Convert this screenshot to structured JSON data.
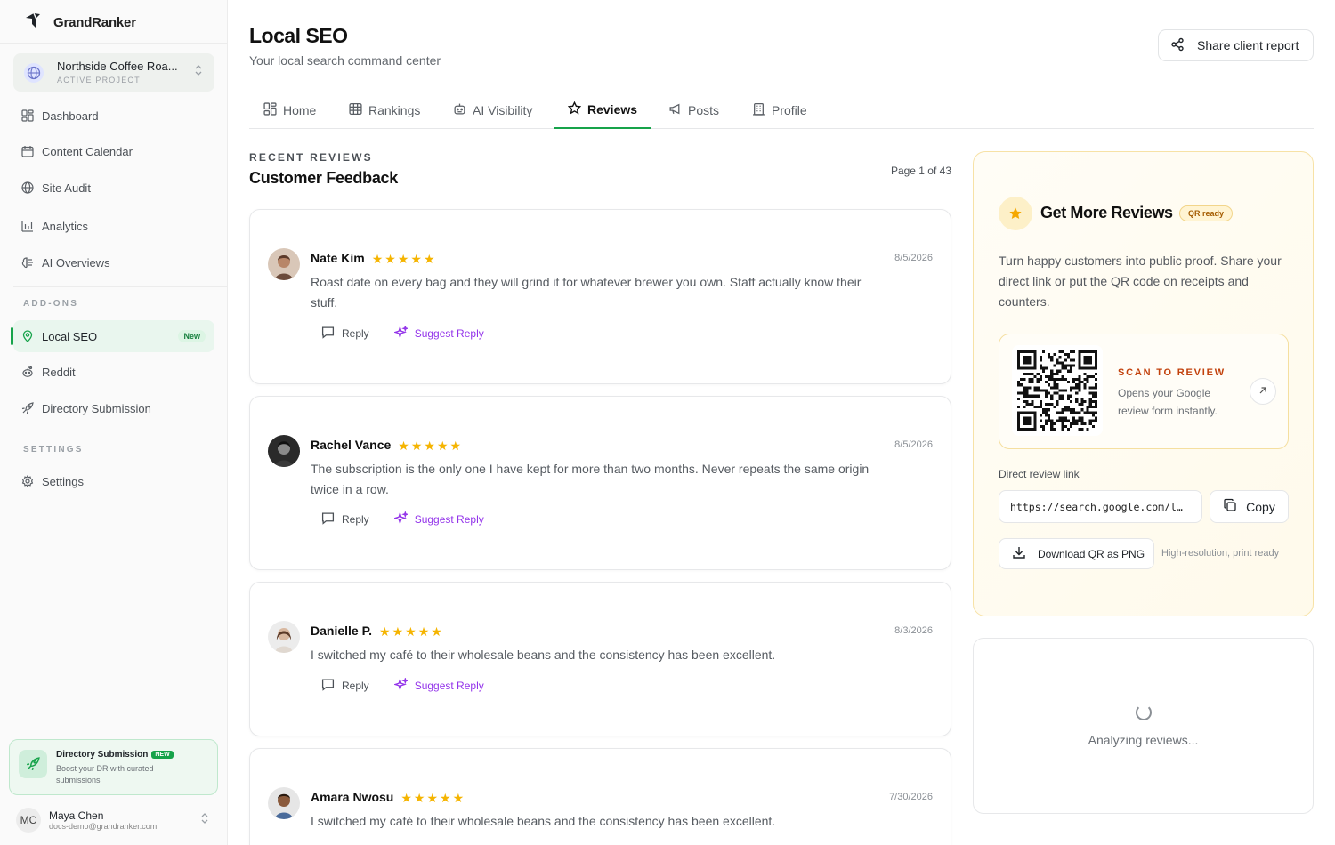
{
  "app": {
    "name": "GrandRanker"
  },
  "project": {
    "name": "Northside Coffee Roa...",
    "label": "ACTIVE PROJECT"
  },
  "sidebar": {
    "items": [
      {
        "label": "Dashboard",
        "icon": "dashboard-icon"
      },
      {
        "label": "Content Calendar",
        "icon": "calendar-icon"
      },
      {
        "label": "Site Audit",
        "icon": "globe-icon"
      },
      {
        "label": "Analytics",
        "icon": "bar-chart-icon"
      },
      {
        "label": "AI Overviews",
        "icon": "ai-brain-icon"
      }
    ],
    "addons_label": "ADD-ONS",
    "addons": [
      {
        "label": "Local SEO",
        "icon": "map-pin-icon",
        "badge": "New",
        "active": true
      },
      {
        "label": "Reddit",
        "icon": "reddit-icon"
      },
      {
        "label": "Directory Submission",
        "icon": "rocket-icon"
      }
    ],
    "settings_label": "SETTINGS",
    "settings": [
      {
        "label": "Settings",
        "icon": "gear-icon"
      }
    ],
    "promo": {
      "title": "Directory Submission",
      "badge": "NEW",
      "text": "Boost your DR with curated submissions"
    },
    "user": {
      "initials": "MC",
      "name": "Maya Chen",
      "email": "docs-demo@grandranker.com"
    }
  },
  "header": {
    "title": "Local SEO",
    "subtitle": "Your local search command center",
    "share_label": "Share client report"
  },
  "tabs": [
    {
      "label": "Home",
      "icon": "home-grid-icon"
    },
    {
      "label": "Rankings",
      "icon": "table-icon"
    },
    {
      "label": "AI Visibility",
      "icon": "robot-icon"
    },
    {
      "label": "Reviews",
      "icon": "star-icon",
      "active": true
    },
    {
      "label": "Posts",
      "icon": "megaphone-icon"
    },
    {
      "label": "Profile",
      "icon": "building-icon"
    }
  ],
  "reviews_section": {
    "eyebrow": "RECENT REVIEWS",
    "title": "Customer Feedback",
    "page_info": "Page 1 of 43"
  },
  "reviews": [
    {
      "name": "Nate Kim",
      "rating": 5,
      "date": "8/5/2026",
      "text": "Roast date on every bag and they will grind it for whatever brewer you own. Staff actually know their stuff.",
      "reply": "Reply",
      "suggest": "Suggest Reply"
    },
    {
      "name": "Rachel Vance",
      "rating": 5,
      "date": "8/5/2026",
      "text": "The subscription is the only one I have kept for more than two months. Never repeats the same origin twice in a row.",
      "reply": "Reply",
      "suggest": "Suggest Reply"
    },
    {
      "name": "Danielle P.",
      "rating": 5,
      "date": "8/3/2026",
      "text": "I switched my café to their wholesale beans and the consistency has been excellent.",
      "reply": "Reply",
      "suggest": "Suggest Reply"
    },
    {
      "name": "Amara Nwosu",
      "rating": 5,
      "date": "7/30/2026",
      "text": "I switched my café to their wholesale beans and the consistency has been excellent."
    }
  ],
  "get_reviews": {
    "title": "Get More Reviews",
    "badge": "QR ready",
    "description": "Turn happy customers into public proof. Share your direct link or put the QR code on receipts and counters.",
    "scan_label": "SCAN TO REVIEW",
    "scan_text": "Opens your Google review form instantly.",
    "link_label": "Direct review link",
    "link_value": "https://search.google.com/l…",
    "copy_label": "Copy",
    "download_label": "Download QR as PNG",
    "download_note": "High-resolution, print ready"
  },
  "analysis": {
    "text": "Analyzing reviews..."
  },
  "colors": {
    "accent": "#16a34a",
    "ai": "#9333ea",
    "star": "#f5b400",
    "scan": "#c2410c"
  }
}
